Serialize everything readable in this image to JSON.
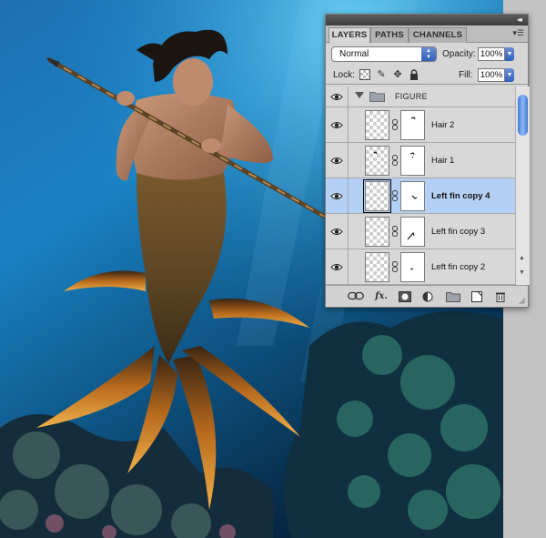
{
  "panel": {
    "tabs": [
      {
        "label": "LAYERS",
        "active": true
      },
      {
        "label": "PATHS",
        "active": false
      },
      {
        "label": "CHANNELS",
        "active": false
      }
    ],
    "blend_mode": "Normal",
    "opacity_label": "Opacity:",
    "opacity_value": "100%",
    "lock_label": "Lock:",
    "fill_label": "Fill:",
    "fill_value": "100%",
    "group": {
      "name": "FIGURE",
      "visible": true,
      "expanded": true
    },
    "layers": [
      {
        "name": "Hair 2",
        "visible": true,
        "selected": false
      },
      {
        "name": "Hair 1",
        "visible": true,
        "selected": false
      },
      {
        "name": "Left fin copy 4",
        "visible": true,
        "selected": true
      },
      {
        "name": "Left fin copy 3",
        "visible": true,
        "selected": false
      },
      {
        "name": "Left fin copy 2",
        "visible": true,
        "selected": false
      }
    ],
    "icons": {
      "footer": [
        "link-icon",
        "fx-icon",
        "mask-icon",
        "adjustment-icon",
        "folder-icon",
        "new-layer-icon",
        "trash-icon"
      ],
      "lock": [
        "lock-transparency-icon",
        "brush-icon",
        "move-icon",
        "lock-icon"
      ]
    }
  },
  "colors": {
    "selection": "#b5d0f5",
    "accent": "#3f79d8",
    "panel_bg": "#d6d6d6"
  }
}
